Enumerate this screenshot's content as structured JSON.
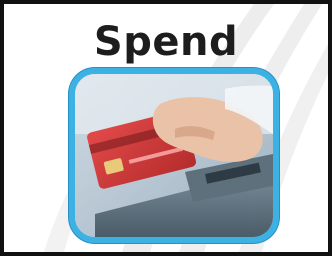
{
  "tile": {
    "title": "Spend",
    "image_subject": "hand-inserting-credit-card-into-payment-terminal",
    "frame_color": "#3bb2e3",
    "border_color": "#111111"
  }
}
